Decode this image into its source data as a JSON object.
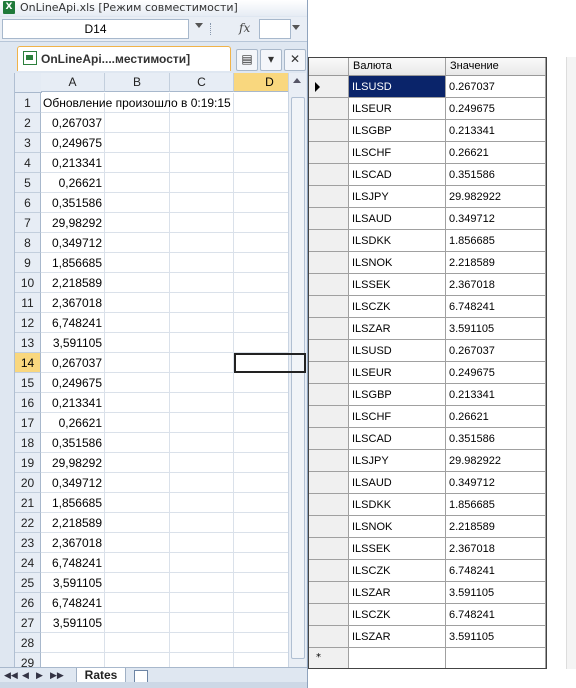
{
  "excel": {
    "title": "OnLineApi.xls  [Режим совместимости]",
    "name_box": "D14",
    "fx_label": "fx",
    "doc_tab": "OnLineApi....местимости]",
    "new_doc_glyph": "▤",
    "tab_list_glyph": "▾",
    "close_glyph": "✕",
    "columns": [
      "A",
      "B",
      "C",
      "D"
    ],
    "active_column": "D",
    "active_row": 14,
    "selected_cell": "D14",
    "rows": [
      {
        "n": "1",
        "a": "Обновление произошло в 0:19:15"
      },
      {
        "n": "2",
        "a": "0,267037"
      },
      {
        "n": "3",
        "a": "0,249675"
      },
      {
        "n": "4",
        "a": "0,213341"
      },
      {
        "n": "5",
        "a": "0,26621"
      },
      {
        "n": "6",
        "a": "0,351586"
      },
      {
        "n": "7",
        "a": "29,98292"
      },
      {
        "n": "8",
        "a": "0,349712"
      },
      {
        "n": "9",
        "a": "1,856685"
      },
      {
        "n": "10",
        "a": "2,218589"
      },
      {
        "n": "11",
        "a": "2,367018"
      },
      {
        "n": "12",
        "a": "6,748241"
      },
      {
        "n": "13",
        "a": "3,591105"
      },
      {
        "n": "14",
        "a": "0,267037"
      },
      {
        "n": "15",
        "a": "0,249675"
      },
      {
        "n": "16",
        "a": "0,213341"
      },
      {
        "n": "17",
        "a": "0,26621"
      },
      {
        "n": "18",
        "a": "0,351586"
      },
      {
        "n": "19",
        "a": "29,98292"
      },
      {
        "n": "20",
        "a": "0,349712"
      },
      {
        "n": "21",
        "a": "1,856685"
      },
      {
        "n": "22",
        "a": "2,218589"
      },
      {
        "n": "23",
        "a": "2,367018"
      },
      {
        "n": "24",
        "a": "6,748241"
      },
      {
        "n": "25",
        "a": "3,591105"
      },
      {
        "n": "26",
        "a": "6,748241"
      },
      {
        "n": "27",
        "a": "3,591105"
      },
      {
        "n": "28",
        "a": ""
      },
      {
        "n": "29",
        "a": ""
      }
    ],
    "sheet_tab": "Rates",
    "nav_glyphs": [
      "◀◀",
      "◀",
      "▶",
      "▶▶"
    ]
  },
  "grid": {
    "headers": [
      "Валюта",
      "Значение"
    ],
    "selected_row": 0,
    "rows": [
      [
        "ILSUSD",
        "0.267037"
      ],
      [
        "ILSEUR",
        "0.249675"
      ],
      [
        "ILSGBP",
        "0.213341"
      ],
      [
        "ILSCHF",
        "0.26621"
      ],
      [
        "ILSCAD",
        "0.351586"
      ],
      [
        "ILSJPY",
        "29.982922"
      ],
      [
        "ILSAUD",
        "0.349712"
      ],
      [
        "ILSDKK",
        "1.856685"
      ],
      [
        "ILSNOK",
        "2.218589"
      ],
      [
        "ILSSEK",
        "2.367018"
      ],
      [
        "ILSCZK",
        "6.748241"
      ],
      [
        "ILSZAR",
        "3.591105"
      ],
      [
        "ILSUSD",
        "0.267037"
      ],
      [
        "ILSEUR",
        "0.249675"
      ],
      [
        "ILSGBP",
        "0.213341"
      ],
      [
        "ILSCHF",
        "0.26621"
      ],
      [
        "ILSCAD",
        "0.351586"
      ],
      [
        "ILSJPY",
        "29.982922"
      ],
      [
        "ILSAUD",
        "0.349712"
      ],
      [
        "ILSDKK",
        "1.856685"
      ],
      [
        "ILSNOK",
        "2.218589"
      ],
      [
        "ILSSEK",
        "2.367018"
      ],
      [
        "ILSCZK",
        "6.748241"
      ],
      [
        "ILSZAR",
        "3.591105"
      ],
      [
        "ILSCZK",
        "6.748241"
      ],
      [
        "ILSZAR",
        "3.591105"
      ]
    ],
    "new_row_glyph": "*",
    "current_row_glyph": "▶"
  },
  "colors": {
    "selection_bg": "#0a246a",
    "active_header": "#f9d77e",
    "excel_green": "#1f7a3a"
  }
}
